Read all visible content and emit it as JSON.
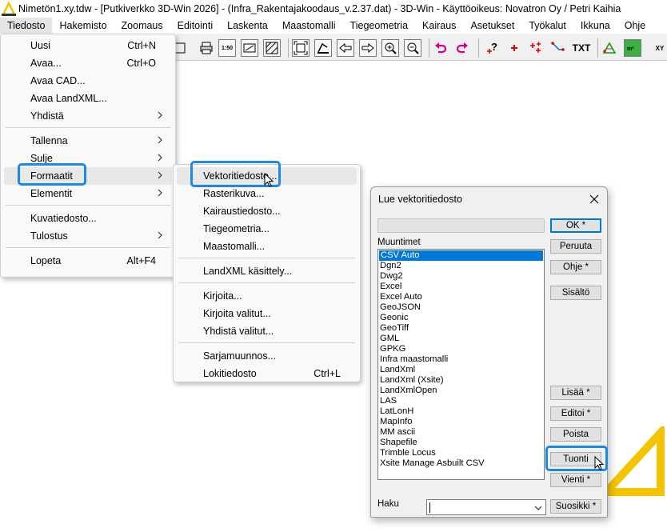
{
  "window": {
    "title": "Nimetön1.xy.tdw - [Putkiverkko 3D-Win 2026] - (Infra_Rakentajakoodaus_v.2.37.dat) - 3D-Win - Käyttöoikeus: Novatron Oy / Petri Kaihia"
  },
  "menubar": [
    "Tiedosto",
    "Hakemisto",
    "Zoomaus",
    "Editointi",
    "Laskenta",
    "Maastomalli",
    "Tiegeometria",
    "Kairaus",
    "Asetukset",
    "Työkalut",
    "Ikkuna",
    "Ohje"
  ],
  "toolbar": {
    "txt_label": "TXT",
    "scale_label": "1:50",
    "xy_label": "XY"
  },
  "file_menu": [
    {
      "label": "Uusi",
      "shortcut": "Ctrl+N"
    },
    {
      "label": "Avaa...",
      "shortcut": "Ctrl+O"
    },
    {
      "label": "Avaa CAD...",
      "shortcut": ""
    },
    {
      "label": "Avaa LandXML...",
      "shortcut": ""
    },
    {
      "label": "Yhdistä",
      "shortcut": ""
    },
    {
      "label": "Tallenna",
      "shortcut": ""
    },
    {
      "label": "Sulje",
      "shortcut": ""
    },
    {
      "label": "Formaatit",
      "shortcut": ""
    },
    {
      "label": "Elementit",
      "shortcut": ""
    },
    {
      "label": "Kuvatiedosto...",
      "shortcut": ""
    },
    {
      "label": "Tulostus",
      "shortcut": ""
    },
    {
      "label": "Lopeta",
      "shortcut": "Alt+F4"
    }
  ],
  "formats_menu": [
    {
      "label": "Vektoritiedosto...",
      "shortcut": ""
    },
    {
      "label": "Rasterikuva...",
      "shortcut": ""
    },
    {
      "label": "Kairaustiedosto...",
      "shortcut": ""
    },
    {
      "label": "Tiegeometria...",
      "shortcut": ""
    },
    {
      "label": "Maastomalli...",
      "shortcut": ""
    },
    {
      "label": "LandXML käsittely...",
      "shortcut": ""
    },
    {
      "label": "Kirjoita...",
      "shortcut": ""
    },
    {
      "label": "Kirjoita valitut...",
      "shortcut": ""
    },
    {
      "label": "Yhdistä valitut...",
      "shortcut": ""
    },
    {
      "label": "Sarjamuunnos...",
      "shortcut": ""
    },
    {
      "label": "Lokitiedosto",
      "shortcut": "Ctrl+L"
    }
  ],
  "dialog": {
    "title": "Lue vektoritiedosto",
    "list_label": "Muuntimet",
    "search_label": "Haku",
    "search_value": "",
    "converters": [
      "CSV Auto",
      "Dgn2",
      "Dwg2",
      "Excel",
      "Excel Auto",
      "GeoJSON",
      "Geonic",
      "GeoTiff",
      "GML",
      "GPKG",
      "Infra maastomalli",
      "LandXml",
      "LandXml (Xsite)",
      "LandXmlOpen",
      "LAS",
      "LatLonH",
      "MapInfo",
      "MM ascii",
      "Shapefile",
      "Trimble Locus",
      "Xsite Manage Asbuilt CSV"
    ],
    "selected": "CSV Auto",
    "buttons": {
      "ok": "OK *",
      "cancel": "Peruuta",
      "help": "Ohje *",
      "contents": "Sisältö",
      "add": "Lisää *",
      "edit": "Editoi *",
      "delete": "Poista",
      "import": "Tuonti",
      "export": "Vienti *",
      "favorites": "Suosikki *"
    }
  },
  "colors": {
    "highlight": "#1e88e5",
    "selection": "#0078d7",
    "logo_yellow": "#f5c400",
    "toolbar_magenta": "#d4008c",
    "toolbar_red": "#e00000"
  }
}
